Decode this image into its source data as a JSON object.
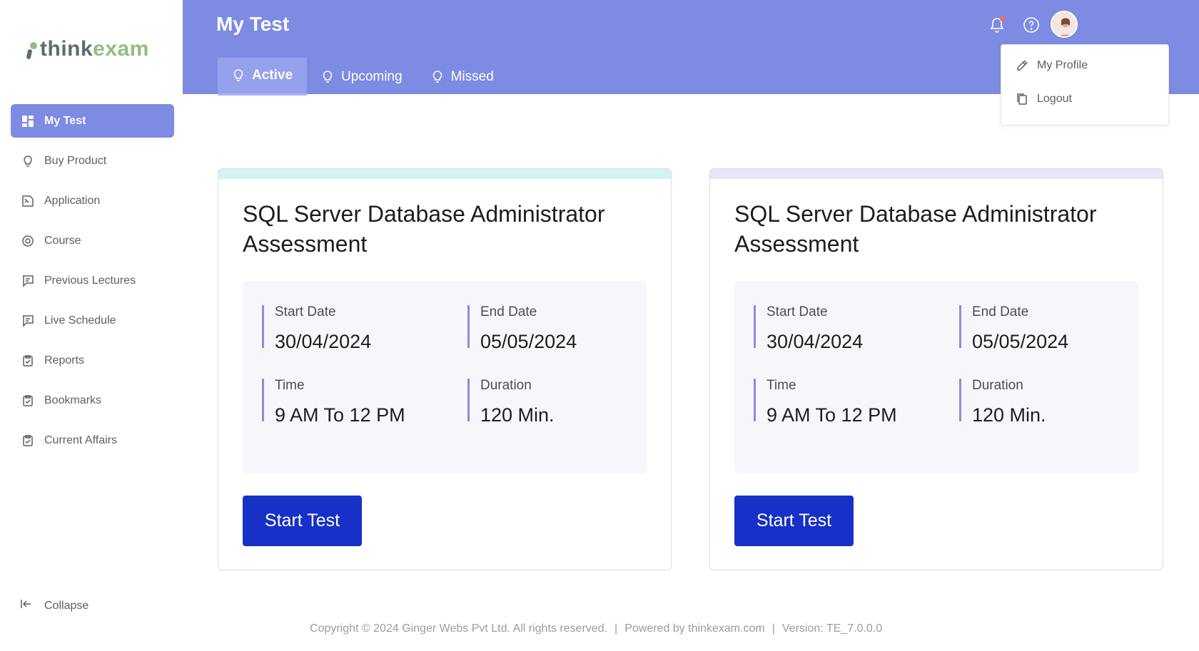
{
  "brand": {
    "text_part1": "think",
    "text_part2": "exam"
  },
  "sidebar": {
    "items": [
      {
        "label": "My Test",
        "icon": "dashboard-icon",
        "active": true
      },
      {
        "label": "Buy Product",
        "icon": "lightbulb-icon"
      },
      {
        "label": "Application",
        "icon": "application-icon"
      },
      {
        "label": "Course",
        "icon": "course-icon"
      },
      {
        "label": "Previous Lectures",
        "icon": "chat-icon"
      },
      {
        "label": "Live Schedule",
        "icon": "chat-icon"
      },
      {
        "label": "Reports",
        "icon": "clipboard-check-icon"
      },
      {
        "label": "Bookmarks",
        "icon": "clipboard-check-icon"
      },
      {
        "label": "Current Affairs",
        "icon": "clipboard-check-icon"
      }
    ],
    "collapse_label": "Collapse"
  },
  "header": {
    "title": "My Test",
    "tabs": [
      {
        "label": "Active",
        "active": true
      },
      {
        "label": "Upcoming"
      },
      {
        "label": "Missed"
      }
    ]
  },
  "user_menu": {
    "items": [
      {
        "label": "My Profile",
        "icon": "pencil-icon"
      },
      {
        "label": "Logout",
        "icon": "copy-icon"
      }
    ]
  },
  "cards": [
    {
      "title": "SQL Server Database Administrator Assessment",
      "strip_color": "#d4f3f5",
      "start_date_label": "Start Date",
      "start_date": "30/04/2024",
      "end_date_label": "End Date",
      "end_date": "05/05/2024",
      "time_label": "Time",
      "time": "9 AM To 12 PM",
      "duration_label": "Duration",
      "duration": "120 Min.",
      "button_label": "Start Test"
    },
    {
      "title": "SQL Server Database Administrator Assessment",
      "strip_color": "#e8e5f6",
      "start_date_label": "Start Date",
      "start_date": "30/04/2024",
      "end_date_label": "End Date",
      "end_date": "05/05/2024",
      "time_label": "Time",
      "time": "9 AM To 12 PM",
      "duration_label": "Duration",
      "duration": "120 Min.",
      "button_label": "Start Test"
    }
  ],
  "footer": {
    "copyright": "Copyright © 2024 Ginger Webs Pvt Ltd. All rights reserved.",
    "powered": "Powered by thinkexam.com",
    "version": "Version: TE_7.0.0.0"
  },
  "colors": {
    "header_bg": "#7d8be3",
    "active_nav": "#7d8be3",
    "button_bg": "#1730c8",
    "accent_line": "#9a86db"
  }
}
